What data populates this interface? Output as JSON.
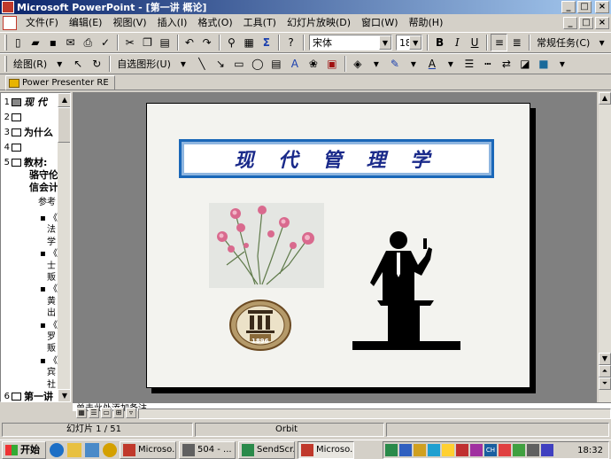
{
  "window": {
    "title": "Microsoft PowerPoint - [第一讲 概论]",
    "minimize": "_",
    "maximize": "□",
    "close": "×"
  },
  "menu": {
    "items": [
      "文件(F)",
      "编辑(E)",
      "视图(V)",
      "插入(I)",
      "格式(O)",
      "工具(T)",
      "幻灯片放映(D)",
      "窗口(W)",
      "帮助(H)"
    ]
  },
  "standard_toolbar": {
    "font_name": "宋体",
    "font_size": "18",
    "bold": "B",
    "italic": "I",
    "underline": "U",
    "task_pane": "常规任务(C)"
  },
  "drawing_toolbar": {
    "draw_label": "绘图(R)",
    "autoshapes_label": "自选图形(U)"
  },
  "tab": {
    "label": "Power Presenter RE"
  },
  "outline": {
    "rows": [
      {
        "num": "1",
        "text": "现 代"
      },
      {
        "num": "2",
        "text": ""
      },
      {
        "num": "3",
        "text": "为什么"
      },
      {
        "num": "4",
        "text": ""
      },
      {
        "num": "5",
        "text": "教材:"
      }
    ],
    "continuation": [
      "骆守伦",
      "信会计"
    ],
    "reference": "参考",
    "bullets": [
      "《",
      "法",
      "学",
      "《",
      "士",
      "贩",
      "《",
      "黄",
      "出",
      "《",
      "罗",
      "贩",
      "《",
      "宾",
      "社"
    ],
    "row6_num": "6",
    "row6_text": "第一讲"
  },
  "slide": {
    "title": "现 代 管 理 学",
    "logo_text": "1896"
  },
  "notes": {
    "text": "单击此处添加备注"
  },
  "status": {
    "slide_counter": "幻灯片 1 / 51",
    "template": "Orbit",
    "language": ""
  },
  "taskbar": {
    "start": "开始",
    "tasks": [
      "Microso...",
      "504 - ...",
      "SendScr...",
      "Microso..."
    ],
    "clock": "18:32"
  },
  "colors": {
    "title_bar_start": "#0a246a",
    "slide_title": "#1a2a8a",
    "title_box_border": "#1a67b8"
  }
}
